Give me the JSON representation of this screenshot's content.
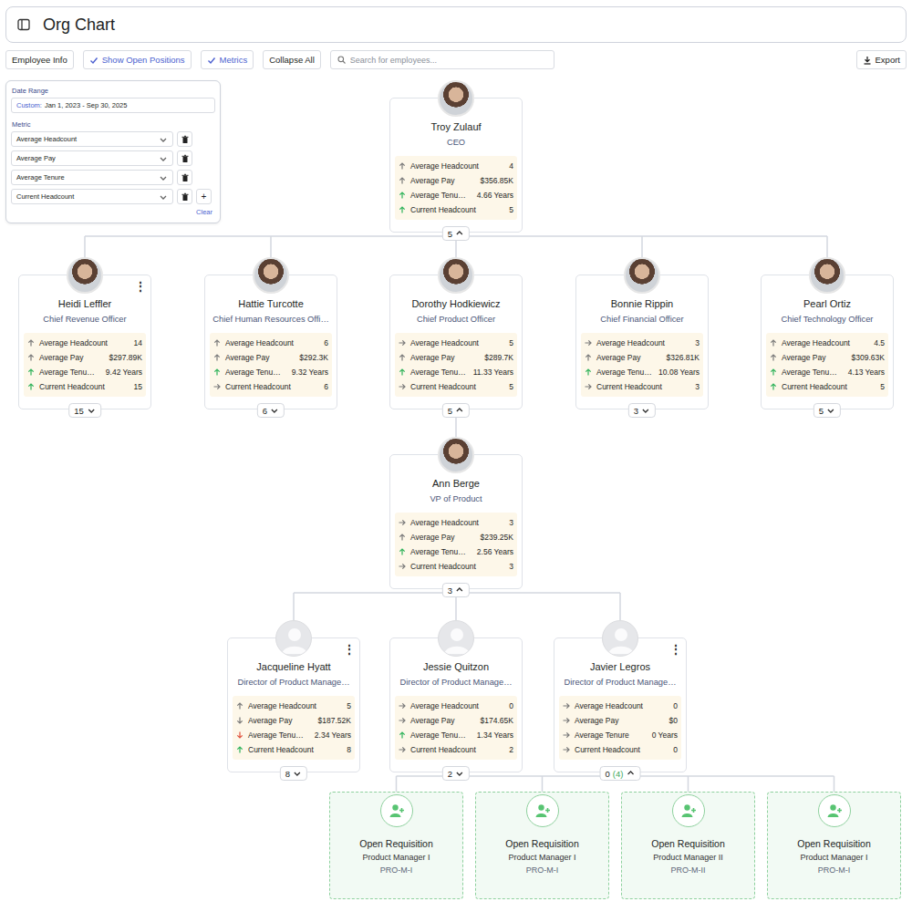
{
  "header": {
    "title": "Org Chart"
  },
  "toolbar": {
    "toggles": [
      {
        "label": "Employee Info",
        "checked": false
      },
      {
        "label": "Show Open Positions",
        "checked": true
      },
      {
        "label": "Metrics",
        "checked": true
      }
    ],
    "collapse_all": "Collapse All",
    "search": {
      "placeholder": "Search for employees..."
    },
    "export": "Export"
  },
  "filters": {
    "date_label": "Date Range",
    "date_prefix": "Custom:",
    "date_value": "Jan 1, 2023 - Sep 30, 2025",
    "metric_label": "Metric",
    "metrics": [
      {
        "value": "Average Headcount"
      },
      {
        "value": "Average Pay"
      },
      {
        "value": "Average Tenure"
      },
      {
        "value": "Current Headcount"
      }
    ],
    "add": "+",
    "clear": "Clear"
  },
  "ceo": {
    "name": "Troy Zulauf",
    "title": "CEO",
    "avatar": "photo",
    "metrics": [
      {
        "label": "Average Headcount",
        "value": "4",
        "trend": "up",
        "color": "#7a7a7a"
      },
      {
        "label": "Average Pay",
        "value": "$356.85K",
        "trend": "up",
        "color": "#7a7a7a"
      },
      {
        "label": "Average Tenu…",
        "value": "4.66 Years",
        "trend": "up",
        "color": "#2fb35a"
      },
      {
        "label": "Current Headcount",
        "value": "5",
        "trend": "up",
        "color": "#2fb35a"
      }
    ],
    "children": {
      "count": "5",
      "expanded": true
    }
  },
  "executives": [
    {
      "name": "Heidi Leffler",
      "title": "Chief Revenue Officer",
      "avatar": "photo",
      "menu": "⋮",
      "metrics": [
        {
          "label": "Average Headcount",
          "value": "14",
          "trend": "up",
          "color": "#7a7a7a"
        },
        {
          "label": "Average Pay",
          "value": "$297.89K",
          "trend": "up",
          "color": "#7a7a7a"
        },
        {
          "label": "Average Tenu…",
          "value": "9.42 Years",
          "trend": "up",
          "color": "#2fb35a"
        },
        {
          "label": "Current Headcount",
          "value": "15",
          "trend": "up",
          "color": "#2fb35a"
        }
      ],
      "children": {
        "count": "15",
        "expanded": false
      }
    },
    {
      "name": "Hattie Turcotte",
      "title": "Chief Human Resources Offi…",
      "avatar": "photo",
      "metrics": [
        {
          "label": "Average Headcount",
          "value": "6",
          "trend": "up",
          "color": "#7a7a7a"
        },
        {
          "label": "Average Pay",
          "value": "$292.3K",
          "trend": "up",
          "color": "#7a7a7a"
        },
        {
          "label": "Average Tenu…",
          "value": "9.32 Years",
          "trend": "up",
          "color": "#2fb35a"
        },
        {
          "label": "Current Headcount",
          "value": "6",
          "trend": "flat",
          "color": "#7a7a7a"
        }
      ],
      "children": {
        "count": "6",
        "expanded": false
      }
    },
    {
      "name": "Dorothy Hodkiewicz",
      "title": "Chief Product Officer",
      "avatar": "photo",
      "metrics": [
        {
          "label": "Average Headcount",
          "value": "5",
          "trend": "flat",
          "color": "#7a7a7a"
        },
        {
          "label": "Average Pay",
          "value": "$289.7K",
          "trend": "up",
          "color": "#7a7a7a"
        },
        {
          "label": "Average Tenu…",
          "value": "11.33 Years",
          "trend": "up",
          "color": "#2fb35a"
        },
        {
          "label": "Current Headcount",
          "value": "5",
          "trend": "flat",
          "color": "#7a7a7a"
        }
      ],
      "children": {
        "count": "5",
        "expanded": true
      }
    },
    {
      "name": "Bonnie Rippin",
      "title": "Chief Financial Officer",
      "avatar": "photo",
      "metrics": [
        {
          "label": "Average Headcount",
          "value": "3",
          "trend": "flat",
          "color": "#7a7a7a"
        },
        {
          "label": "Average Pay",
          "value": "$326.81K",
          "trend": "up",
          "color": "#7a7a7a"
        },
        {
          "label": "Average Tenu…",
          "value": "10.08 Years",
          "trend": "up",
          "color": "#2fb35a"
        },
        {
          "label": "Current Headcount",
          "value": "3",
          "trend": "flat",
          "color": "#7a7a7a"
        }
      ],
      "children": {
        "count": "3",
        "expanded": false
      }
    },
    {
      "name": "Pearl Ortiz",
      "title": "Chief Technology Officer",
      "avatar": "photo",
      "metrics": [
        {
          "label": "Average Headcount",
          "value": "4.5",
          "trend": "up",
          "color": "#7a7a7a"
        },
        {
          "label": "Average Pay",
          "value": "$309.63K",
          "trend": "up",
          "color": "#7a7a7a"
        },
        {
          "label": "Average Tenu…",
          "value": "4.13 Years",
          "trend": "up",
          "color": "#2fb35a"
        },
        {
          "label": "Current Headcount",
          "value": "5",
          "trend": "up",
          "color": "#2fb35a"
        }
      ],
      "children": {
        "count": "5",
        "expanded": false
      }
    }
  ],
  "vp": {
    "name": "Ann Berge",
    "title": "VP of Product",
    "avatar": "photo",
    "metrics": [
      {
        "label": "Average Headcount",
        "value": "3",
        "trend": "flat",
        "color": "#7a7a7a"
      },
      {
        "label": "Average Pay",
        "value": "$239.25K",
        "trend": "up",
        "color": "#7a7a7a"
      },
      {
        "label": "Average Tenu…",
        "value": "2.56 Years",
        "trend": "up",
        "color": "#2fb35a"
      },
      {
        "label": "Current Headcount",
        "value": "3",
        "trend": "flat",
        "color": "#7a7a7a"
      }
    ],
    "children": {
      "count": "3",
      "expanded": true
    }
  },
  "directors": [
    {
      "name": "Jacqueline Hyatt",
      "title": "Director of Product Manage…",
      "avatar": "placeholder",
      "menu": "⋮",
      "metrics": [
        {
          "label": "Average Headcount",
          "value": "5",
          "trend": "up",
          "color": "#7a7a7a"
        },
        {
          "label": "Average Pay",
          "value": "$187.52K",
          "trend": "down",
          "color": "#7a7a7a"
        },
        {
          "label": "Average Tenu…",
          "value": "2.34 Years",
          "trend": "down",
          "color": "#e0533f"
        },
        {
          "label": "Current Headcount",
          "value": "8",
          "trend": "up",
          "color": "#2fb35a"
        }
      ],
      "children": {
        "count": "8",
        "expanded": false
      }
    },
    {
      "name": "Jessie Quitzon",
      "title": "Director of Product Manage…",
      "avatar": "placeholder",
      "metrics": [
        {
          "label": "Average Headcount",
          "value": "0",
          "trend": "flat",
          "color": "#7a7a7a"
        },
        {
          "label": "Average Pay",
          "value": "$174.65K",
          "trend": "flat",
          "color": "#7a7a7a"
        },
        {
          "label": "Average Tenu…",
          "value": "1.34 Years",
          "trend": "up",
          "color": "#2fb35a"
        },
        {
          "label": "Current Headcount",
          "value": "2",
          "trend": "flat",
          "color": "#7a7a7a"
        }
      ],
      "children": {
        "count": "2",
        "expanded": false
      }
    },
    {
      "name": "Javier Legros",
      "title": "Director of Product Manage…",
      "avatar": "placeholder",
      "menu": "⋮",
      "metrics": [
        {
          "label": "Average Headcount",
          "value": "0",
          "trend": "flat",
          "color": "#7a7a7a"
        },
        {
          "label": "Average Pay",
          "value": "$0",
          "trend": "flat",
          "color": "#7a7a7a"
        },
        {
          "label": "Average Tenure",
          "value": "0 Years",
          "trend": "flat",
          "color": "#7a7a7a"
        },
        {
          "label": "Current Headcount",
          "value": "0",
          "trend": "flat",
          "color": "#7a7a7a"
        }
      ],
      "children": {
        "count": "0",
        "extra": "(4)",
        "expanded": true
      }
    }
  ],
  "open_requisitions": [
    {
      "title": "Open Requisition",
      "role": "Product Manager I",
      "code": "PRO-M-I"
    },
    {
      "title": "Open Requisition",
      "role": "Product Manager I",
      "code": "PRO-M-I"
    },
    {
      "title": "Open Requisition",
      "role": "Product Manager II",
      "code": "PRO-M-II"
    },
    {
      "title": "Open Requisition",
      "role": "Product Manager I",
      "code": "PRO-M-I"
    }
  ]
}
